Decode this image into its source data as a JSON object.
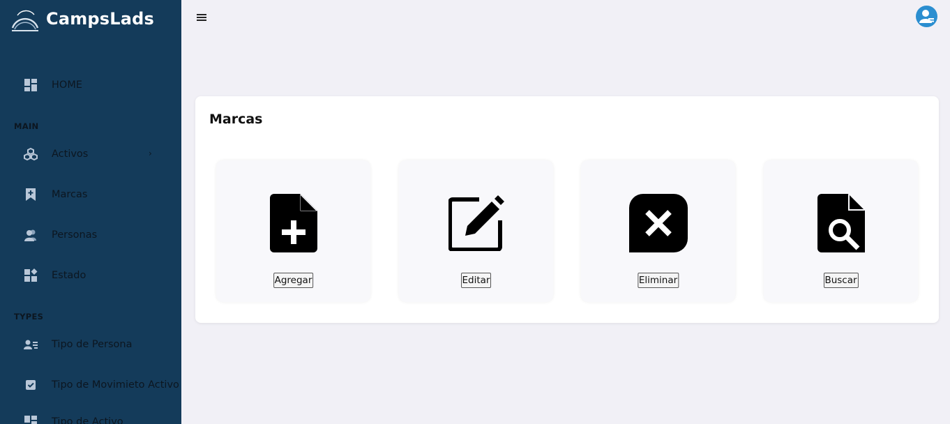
{
  "brand": {
    "name": "CampsLads"
  },
  "sidebar": {
    "home": {
      "label": "HOME",
      "icon": "dashboard-icon"
    },
    "sections": [
      {
        "title": "MAIN"
      },
      {
        "title": "TYPES"
      }
    ],
    "main_items": [
      {
        "label": "Activos",
        "icon": "cubes-icon",
        "chevron": "›"
      },
      {
        "label": "Marcas",
        "icon": "bookmark-plus-icon"
      },
      {
        "label": "Personas",
        "icon": "users-icon"
      },
      {
        "label": "Estado",
        "icon": "widgets-icon"
      }
    ],
    "type_items": [
      {
        "label": "Tipo de Persona",
        "icon": "person-list-icon"
      },
      {
        "label": "Tipo de Movimieto Activo",
        "icon": "checkbox-icon"
      },
      {
        "label": "Tipo de Activo",
        "icon": "dashboard-icon"
      }
    ]
  },
  "topbar": {
    "menu_icon": "hamburger-icon",
    "avatar_icon": "user-avatar-icon"
  },
  "page": {
    "title": "Marcas",
    "actions": [
      {
        "label": "Agregar",
        "icon": "file-plus-icon"
      },
      {
        "label": "Editar",
        "icon": "edit-icon"
      },
      {
        "label": "Eliminar",
        "icon": "close-box-icon"
      },
      {
        "label": "Buscar",
        "icon": "file-search-icon"
      }
    ]
  },
  "colors": {
    "sidebar_bg": "#143b5a",
    "sidebar_icon": "#b9c7d8",
    "page_bg": "#f1f0f6",
    "avatar_bg": "#2b8ed0"
  }
}
